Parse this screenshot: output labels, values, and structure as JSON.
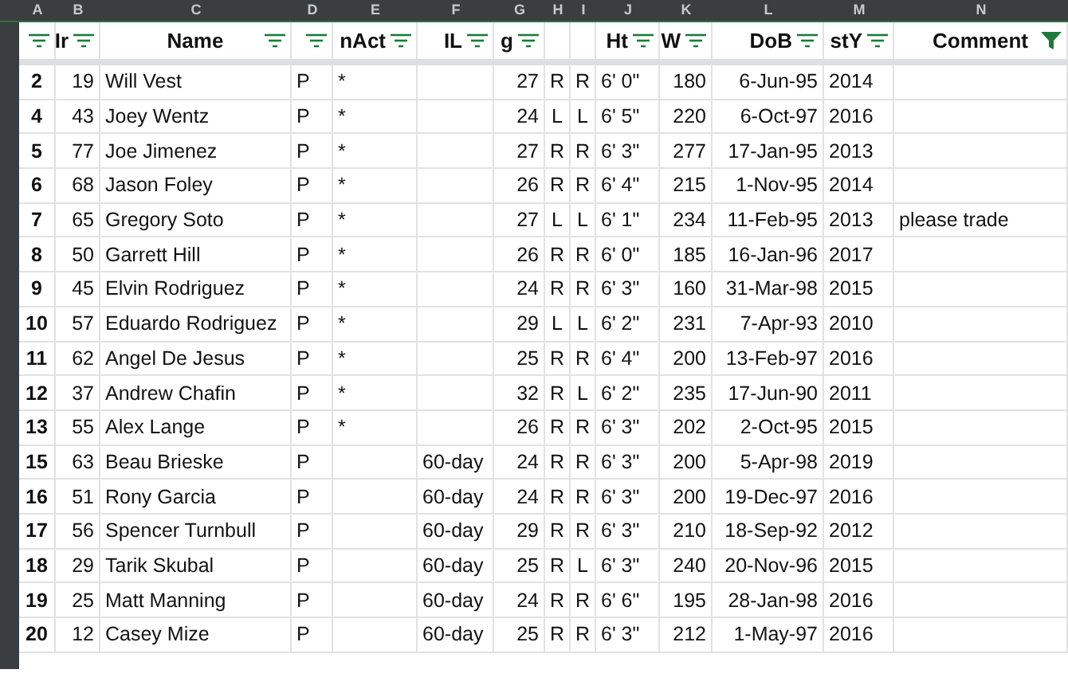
{
  "columns": [
    {
      "letter": "A",
      "filtered": false
    },
    {
      "letter": "B",
      "header": "Ir",
      "filtered": false
    },
    {
      "letter": "C",
      "header": "Name",
      "filtered": false
    },
    {
      "letter": "D",
      "filtered": false
    },
    {
      "letter": "E",
      "header": "nAct",
      "filtered": false
    },
    {
      "letter": "F",
      "header": "IL",
      "filtered": false
    },
    {
      "letter": "G",
      "header": "g",
      "filtered": false
    },
    {
      "letter": "H"
    },
    {
      "letter": "I"
    },
    {
      "letter": "J",
      "header": "Ht",
      "filtered": false
    },
    {
      "letter": "K",
      "header": "W",
      "filtered": false
    },
    {
      "letter": "L",
      "header": "DoB",
      "filtered": false
    },
    {
      "letter": "M",
      "header": "stY",
      "filtered": false
    },
    {
      "letter": "N",
      "header": "Comment",
      "filtered": true
    }
  ],
  "rows": [
    [
      "2",
      "19",
      "Will Vest",
      "P",
      "*",
      null,
      "27",
      "R",
      "R",
      "6' 0\"",
      "180",
      "6-Jun-95",
      "2014",
      null
    ],
    [
      "4",
      "43",
      "Joey Wentz",
      "P",
      "*",
      null,
      "24",
      "L",
      "L",
      "6' 5\"",
      "220",
      "6-Oct-97",
      "2016",
      null
    ],
    [
      "5",
      "77",
      "Joe Jimenez",
      "P",
      "*",
      null,
      "27",
      "R",
      "R",
      "6' 3\"",
      "277",
      "17-Jan-95",
      "2013",
      null
    ],
    [
      "6",
      "68",
      "Jason Foley",
      "P",
      "*",
      null,
      "26",
      "R",
      "R",
      "6' 4\"",
      "215",
      "1-Nov-95",
      "2014",
      null
    ],
    [
      "7",
      "65",
      "Gregory Soto",
      "P",
      "*",
      null,
      "27",
      "L",
      "L",
      "6' 1\"",
      "234",
      "11-Feb-95",
      "2013",
      "please trade"
    ],
    [
      "8",
      "50",
      "Garrett Hill",
      "P",
      "*",
      null,
      "26",
      "R",
      "R",
      "6' 0\"",
      "185",
      "16-Jan-96",
      "2017",
      null
    ],
    [
      "9",
      "45",
      "Elvin Rodriguez",
      "P",
      "*",
      null,
      "24",
      "R",
      "R",
      "6' 3\"",
      "160",
      "31-Mar-98",
      "2015",
      null
    ],
    [
      "10",
      "57",
      "Eduardo Rodriguez",
      "P",
      "*",
      null,
      "29",
      "L",
      "L",
      "6' 2\"",
      "231",
      "7-Apr-93",
      "2010",
      null
    ],
    [
      "11",
      "62",
      "Angel De Jesus",
      "P",
      "*",
      null,
      "25",
      "R",
      "R",
      "6' 4\"",
      "200",
      "13-Feb-97",
      "2016",
      null
    ],
    [
      "12",
      "37",
      "Andrew Chafin",
      "P",
      "*",
      null,
      "32",
      "R",
      "L",
      "6' 2\"",
      "235",
      "17-Jun-90",
      "2011",
      null
    ],
    [
      "13",
      "55",
      "Alex Lange",
      "P",
      "*",
      null,
      "26",
      "R",
      "R",
      "6' 3\"",
      "202",
      "2-Oct-95",
      "2015",
      null
    ],
    [
      "15",
      "63",
      "Beau Brieske",
      "P",
      null,
      "60-day",
      "24",
      "R",
      "R",
      "6' 3\"",
      "200",
      "5-Apr-98",
      "2019",
      null
    ],
    [
      "16",
      "51",
      "Rony Garcia",
      "P",
      null,
      "60-day",
      "24",
      "R",
      "R",
      "6' 3\"",
      "200",
      "19-Dec-97",
      "2016",
      null
    ],
    [
      "17",
      "56",
      "Spencer Turnbull",
      "P",
      null,
      "60-day",
      "29",
      "R",
      "R",
      "6' 3\"",
      "210",
      "18-Sep-92",
      "2012",
      null
    ],
    [
      "18",
      "29",
      "Tarik Skubal",
      "P",
      null,
      "60-day",
      "25",
      "R",
      "L",
      "6' 3\"",
      "240",
      "20-Nov-96",
      "2015",
      null
    ],
    [
      "19",
      "25",
      "Matt Manning",
      "P",
      null,
      "60-day",
      "24",
      "R",
      "R",
      "6' 6\"",
      "195",
      "28-Jan-98",
      "2016",
      null
    ],
    [
      "20",
      "12",
      "Casey Mize",
      "P",
      null,
      "60-day",
      "25",
      "R",
      "R",
      "6' 3\"",
      "212",
      "1-May-97",
      "2016",
      null
    ]
  ]
}
